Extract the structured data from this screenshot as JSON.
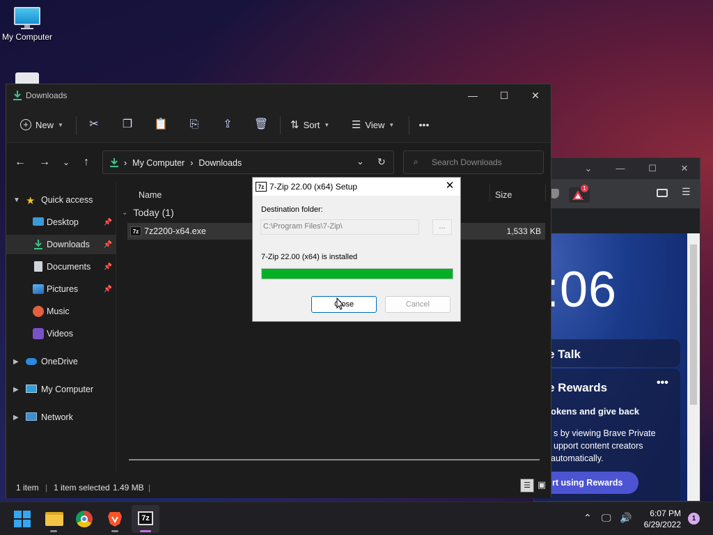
{
  "desktop": {
    "icons": [
      {
        "label": "My Computer"
      },
      {
        "label": ""
      }
    ]
  },
  "explorer": {
    "title": "Downloads",
    "commands": {
      "new_label": "New",
      "sort_label": "Sort",
      "view_label": "View"
    },
    "address": {
      "crumbs": [
        "My Computer",
        "Downloads"
      ],
      "search_placeholder": "Search Downloads"
    },
    "nav": {
      "quick_access": "Quick access",
      "items": [
        {
          "label": "Desktop",
          "icon": "desktop-folder-icon",
          "pinned": true
        },
        {
          "label": "Downloads",
          "icon": "download-folder-icon",
          "pinned": true,
          "selected": true
        },
        {
          "label": "Documents",
          "icon": "documents-folder-icon",
          "pinned": true
        },
        {
          "label": "Pictures",
          "icon": "pictures-folder-icon",
          "pinned": true
        },
        {
          "label": "Music",
          "icon": "music-folder-icon",
          "pinned": false
        },
        {
          "label": "Videos",
          "icon": "videos-folder-icon",
          "pinned": false
        }
      ],
      "onedrive": "OneDrive",
      "my_computer": "My Computer",
      "network": "Network"
    },
    "columns": {
      "name": "Name",
      "size": "Size"
    },
    "group": {
      "label": "Today (1)"
    },
    "files": [
      {
        "name": "7z2200-x64.exe",
        "size": "1,533 KB",
        "selected": true
      }
    ],
    "status": {
      "count": "1 item",
      "selection": "1 item selected",
      "selection_size": "1.49 MB"
    }
  },
  "dialog": {
    "title": "7-Zip 22.00 (x64) Setup",
    "icon_text": "7z",
    "destination_label": "Destination folder:",
    "destination_path": "C:\\Program Files\\7-Zip\\",
    "browse_label": "...",
    "status_text": "7-Zip 22.00 (x64) is installed",
    "progress": 1.0,
    "progress_color": "#06b025",
    "close_label": "Close",
    "cancel_label": "Cancel"
  },
  "brave": {
    "clock_partial": ":06",
    "card1_title": "e Talk",
    "card2_title": "e Rewards",
    "card2_sub": "okens and give back",
    "card2_body": [
      "s by viewing Brave Private",
      "upport content creators",
      "automatically."
    ],
    "card2_button": "rt using Rewards",
    "badge_count": "1"
  },
  "taskbar": {
    "apps": [
      {
        "name": "start-button"
      },
      {
        "name": "file-explorer"
      },
      {
        "name": "chrome"
      },
      {
        "name": "brave"
      },
      {
        "name": "7zip",
        "icon_text": "7z"
      }
    ],
    "time": "6:07 PM",
    "date": "6/29/2022",
    "notifications": "1"
  }
}
